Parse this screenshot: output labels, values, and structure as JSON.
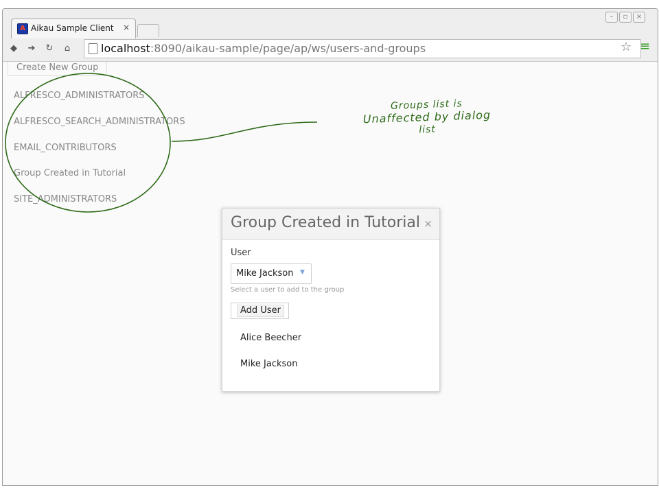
{
  "browser": {
    "tab_title": "Aikau Sample Client",
    "tab_close": "×",
    "favicon_letter": "A",
    "url_host": "localhost",
    "url_path": ":8090/aikau-sample/page/ap/ws/users-and-groups",
    "accent_color": "#3a9a2a"
  },
  "page": {
    "create_group_label": "Create New Group",
    "groups": [
      "ALFRESCO_ADMINISTRATORS",
      "ALFRESCO_SEARCH_ADMINISTRATORS",
      "EMAIL_CONTRIBUTORS",
      "Group Created in Tutorial",
      "SITE_ADMINISTRATORS"
    ]
  },
  "dialog": {
    "title": "Group Created in Tutorial",
    "close_glyph": "×",
    "user_label": "User",
    "selected_user": "Mike Jackson",
    "hint": "Select a user to add to the group",
    "add_user_label": "Add User",
    "members": [
      "Alice Beecher",
      "Mike Jackson"
    ]
  },
  "annotation": {
    "lines": [
      "Groups list is",
      "Unaffected by dialog",
      "list"
    ],
    "color": "#2d6a18"
  }
}
